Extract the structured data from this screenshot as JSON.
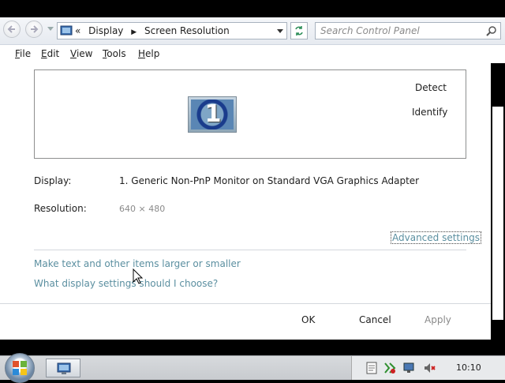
{
  "address": {
    "crumb_sep": "«",
    "crumbs": [
      "Display",
      "Screen Resolution"
    ]
  },
  "search": {
    "placeholder": "Search Control Panel"
  },
  "menu": [
    "File",
    "Edit",
    "View",
    "Tools",
    "Help"
  ],
  "monitor_area": {
    "monitor_number": "1",
    "detect_label": "Detect",
    "identify_label": "Identify"
  },
  "fields": {
    "display_label": "Display:",
    "display_value": "1. Generic Non-PnP Monitor on Standard VGA Graphics Adapter",
    "resolution_label": "Resolution:",
    "resolution_value": "640 × 480"
  },
  "links": {
    "advanced": "Advanced settings",
    "larger_text": "Make text and other items larger or smaller",
    "what_settings": "What display settings should I choose?"
  },
  "buttons": {
    "ok": "OK",
    "cancel": "Cancel",
    "apply": "Apply"
  },
  "taskbar": {
    "clock": "10:10"
  },
  "colors": {
    "link": "#5b8fa0",
    "disabled": "#8a8a8a"
  },
  "icons": [
    "back-arrow-icon",
    "forward-arrow-icon",
    "control-panel-icon",
    "refresh-icon",
    "search-icon",
    "windows-logo-icon",
    "display-app-icon",
    "action-center-icon",
    "network-icon",
    "volume-muted-icon"
  ]
}
